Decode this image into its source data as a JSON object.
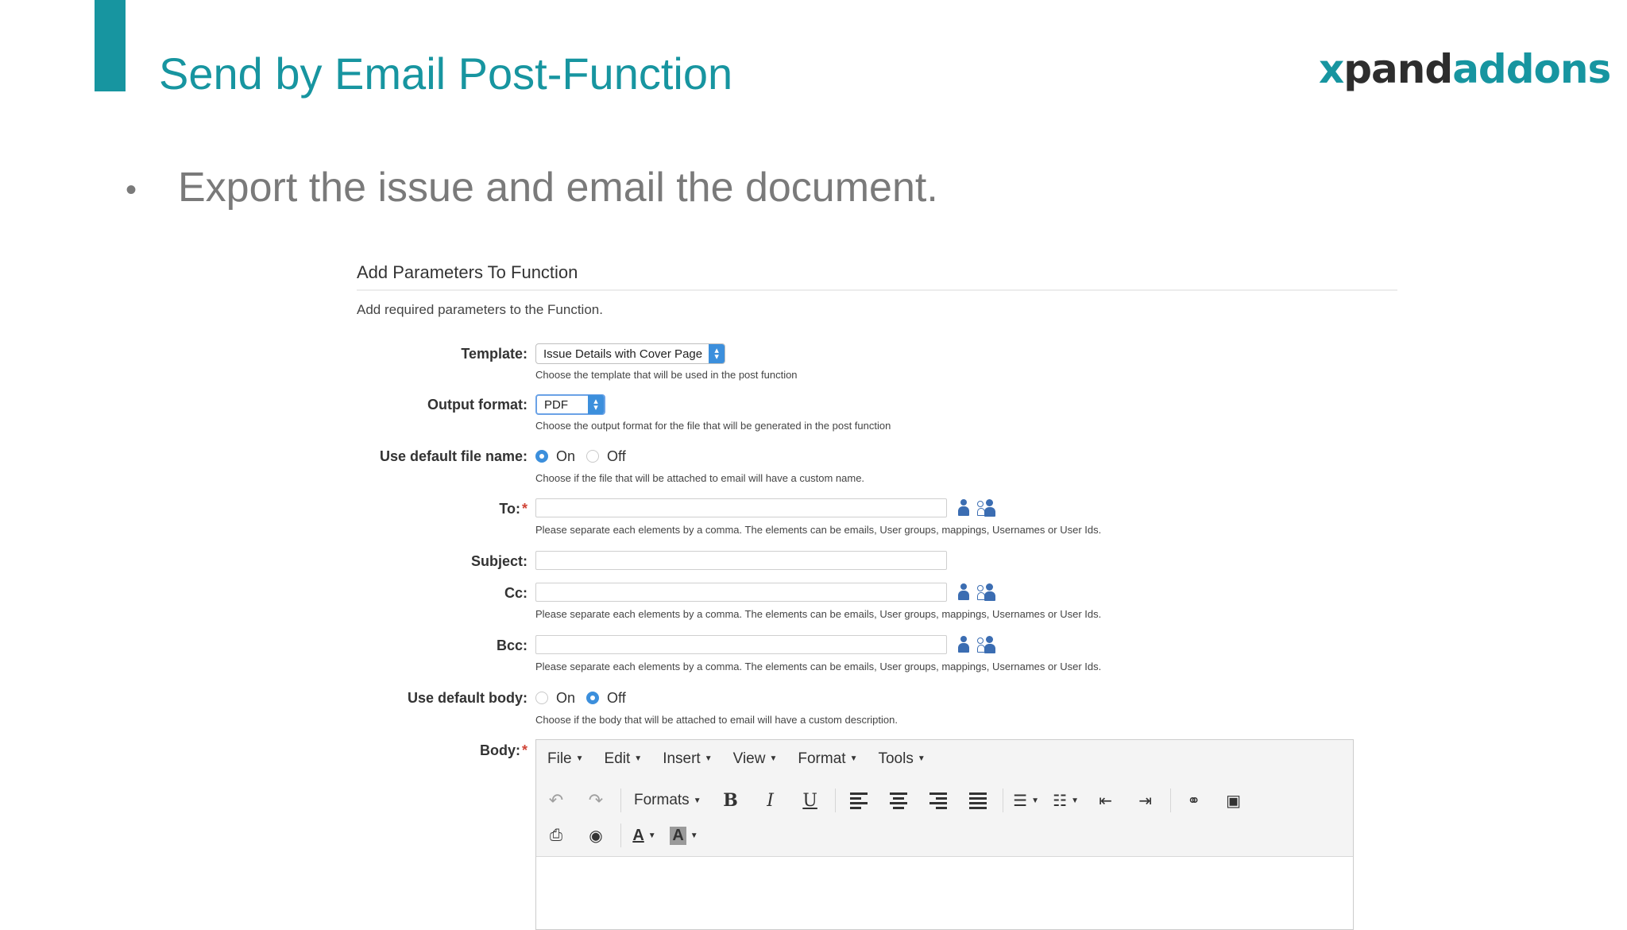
{
  "slide": {
    "title": "Send by Email Post-Function",
    "logo": {
      "x": "x",
      "pand": "pand",
      "addons": "addons"
    },
    "bullet": "Export the issue and email the document."
  },
  "panel": {
    "title": "Add Parameters To Function",
    "description": "Add required parameters to the Function."
  },
  "form": {
    "template": {
      "label": "Template:",
      "value": "Issue Details with Cover Page",
      "help": "Choose the template that will be used in the post function"
    },
    "output_format": {
      "label": "Output format:",
      "value": "PDF",
      "help": "Choose the output format for the file that will be generated in the post function"
    },
    "use_default_file_name": {
      "label": "Use default file name:",
      "on_label": "On",
      "off_label": "Off",
      "selected": "On",
      "help": "Choose if the file that will be attached to email will have a custom name."
    },
    "to": {
      "label": "To:",
      "required_mark": "*",
      "value": "",
      "help": "Please separate each elements by a comma. The elements can be emails, User groups, mappings, Usernames or User Ids."
    },
    "subject": {
      "label": "Subject:",
      "value": ""
    },
    "cc": {
      "label": "Cc:",
      "value": "",
      "help": "Please separate each elements by a comma. The elements can be emails, User groups, mappings, Usernames or User Ids."
    },
    "bcc": {
      "label": "Bcc:",
      "value": "",
      "help": "Please separate each elements by a comma. The elements can be emails, User groups, mappings, Usernames or User Ids."
    },
    "use_default_body": {
      "label": "Use default body:",
      "on_label": "On",
      "off_label": "Off",
      "selected": "Off",
      "help": "Choose if the body that will be attached to email will have a custom description."
    },
    "body": {
      "label": "Body:",
      "required_mark": "*"
    }
  },
  "editor": {
    "menus": [
      "File",
      "Edit",
      "Insert",
      "View",
      "Format",
      "Tools"
    ],
    "formats_label": "Formats",
    "text_color_label": "A",
    "bg_color_label": "A",
    "icons": [
      "undo-icon",
      "redo-icon",
      "bold-icon",
      "italic-icon",
      "underline-icon",
      "align-left-icon",
      "align-center-icon",
      "align-right-icon",
      "justify-icon",
      "bullet-list-icon",
      "numbered-list-icon",
      "outdent-icon",
      "indent-icon",
      "link-icon",
      "image-icon",
      "print-icon",
      "preview-icon"
    ]
  },
  "colors": {
    "accent": "#1795a0",
    "radio_selected": "#3c8fdc",
    "required": "#d04437",
    "user_icon": "#3b6db2"
  }
}
